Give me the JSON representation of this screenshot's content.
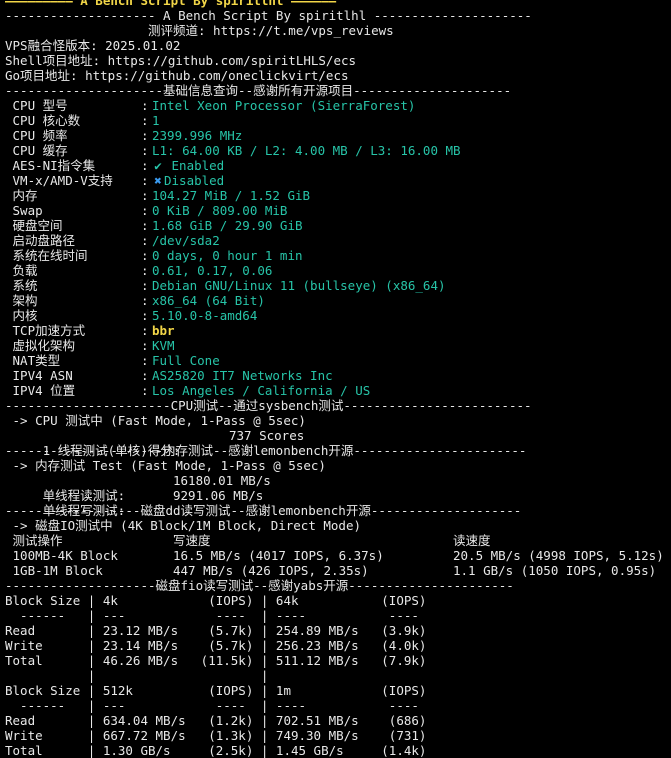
{
  "header": {
    "top_cut": "————————— A Bench Script By spiritlhl ——————",
    "title": "-------------------- A Bench Script By spiritlhl ---------------------",
    "channel": "                   测评频道: https://t.me/vps_reviews",
    "version": "VPS融合怪版本: 2025.01.02",
    "shell_repo": "Shell项目地址: https://github.com/spiritLHLS/ecs",
    "go_repo": "Go项目地址: https://github.com/oneclickvirt/ecs"
  },
  "sections": {
    "basic": "---------------------基础信息查询--感谢所有开源项目---------------------",
    "cpu": "----------------------CPU测试--通过sysbench测试-------------------------",
    "memory": "---------------------内存测试--感谢lemonbench开源-----------------------",
    "disk_dd": "------------------磁盘dd读写测试--感谢lemonbench开源--------------------",
    "disk_fio": "--------------------磁盘fio读写测试--感谢yabs开源----------------------"
  },
  "sysinfo": [
    {
      "label": " CPU 型号",
      "value": "Intel Xeon Processor (SierraForest)"
    },
    {
      "label": " CPU 核心数",
      "value": "1"
    },
    {
      "label": " CPU 频率",
      "value": "2399.996 MHz"
    },
    {
      "label": " CPU 缓存",
      "value": "L1: 64.00 KB / L2: 4.00 MB / L3: 16.00 MB"
    },
    {
      "label": " AES-NI指令集",
      "value": "Enabled",
      "icon": "check-icon"
    },
    {
      "label": " VM-x/AMD-V支持",
      "value": "Disabled",
      "icon": "cross-icon"
    },
    {
      "label": " 内存",
      "value": "104.27 MiB / 1.52 GiB"
    },
    {
      "label": " Swap",
      "value": "0 KiB / 809.00 MiB"
    },
    {
      "label": " 硬盘空间",
      "value": "1.68 GiB / 29.90 GiB"
    },
    {
      "label": " 启动盘路径",
      "value": "/dev/sda2"
    },
    {
      "label": " 系统在线时间",
      "value": "0 days, 0 hour 1 min"
    },
    {
      "label": " 负载",
      "value": "0.61, 0.17, 0.06"
    },
    {
      "label": " 系统",
      "value": "Debian GNU/Linux 11 (bullseye) (x86_64)"
    },
    {
      "label": " 架构",
      "value": "x86_64 (64 Bit)"
    },
    {
      "label": " 内核",
      "value": "5.10.0-8-amd64"
    },
    {
      "label": " TCP加速方式",
      "value": "bbr",
      "highlight": true
    },
    {
      "label": " 虚拟化架构",
      "value": "KVM"
    },
    {
      "label": " NAT类型",
      "value": "Full Cone"
    },
    {
      "label": " IPV4 ASN",
      "value": "AS25820 IT7 Networks Inc"
    },
    {
      "label": " IPV4 位置",
      "value": "Los Angeles / California / US"
    }
  ],
  "cpu_test": {
    "mode": " -> CPU 测试中 (Fast Mode, 1-Pass @ 5sec)",
    "score_label": " 1 线程测试(单核)得分:",
    "score_value": "737 Scores"
  },
  "memory_test": {
    "mode": " -> 内存测试 Test (Fast Mode, 1-Pass @ 5sec)",
    "read_label": " 单线程读测试:",
    "read_value": "16180.01 MB/s",
    "write_label": " 单线程写测试:",
    "write_value": "9291.06 MB/s"
  },
  "dd_test": {
    "mode": " -> 磁盘IO测试中 (4K Block/1M Block, Direct Mode)",
    "headers": [
      " 测试操作",
      "写速度",
      "读速度"
    ],
    "rows": [
      [
        " 100MB-4K Block",
        "16.5 MB/s (4017 IOPS, 6.37s)",
        "20.5 MB/s (4998 IOPS, 5.12s)"
      ],
      [
        " 1GB-1M Block",
        "447 MB/s (426 IOPS, 2.35s)",
        "1.1 GB/s (1050 IOPS, 0.95s)"
      ]
    ]
  },
  "fio_lines": [
    "Block Size | 4k            (IOPS) | 64k           (IOPS)",
    "  ------   | ---            ----  | ----           ----",
    "Read       | 23.12 MB/s    (5.7k) | 254.89 MB/s   (3.9k)",
    "Write      | 23.14 MB/s    (5.7k) | 256.23 MB/s   (4.0k)",
    "Total      | 46.26 MB/s   (11.5k) | 511.12 MB/s   (7.9k)",
    "           |                      |",
    "Block Size | 512k          (IOPS) | 1m            (IOPS)",
    "  ------   | ---            ----  | ----           ----",
    "Read       | 634.04 MB/s   (1.2k) | 702.51 MB/s    (686)",
    "Write      | 667.72 MB/s   (1.3k) | 749.30 MB/s    (731)",
    "Total      | 1.30 GB/s     (2.5k) | 1.45 GB/s     (1.4k)"
  ],
  "colors": {
    "background": "#000000",
    "text": "#e8e8e8",
    "value": "#27c4a8",
    "highlight": "#f2d648",
    "cross_icon": "#3a9bf0"
  }
}
